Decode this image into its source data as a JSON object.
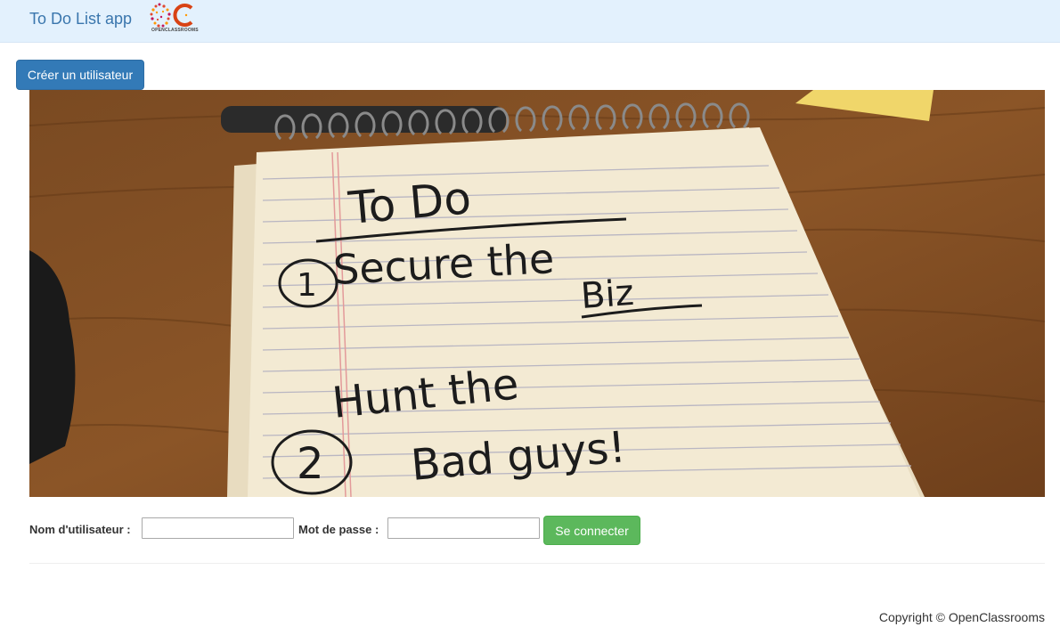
{
  "navbar": {
    "brand": "To Do List app",
    "logo_text": "OPENCLASSROOMS"
  },
  "actions": {
    "create_user_label": "Créer un utilisateur"
  },
  "hero": {
    "notebook_title": "To Do",
    "item_1": "Secure the",
    "item_1_b": "Biz",
    "item_2_a": "Hunt the",
    "item_2_b": "Bad guys!",
    "num_1": "1",
    "num_2": "2"
  },
  "login": {
    "username_label": "Nom d'utilisateur :",
    "username_value": "",
    "password_label": "Mot de passe :",
    "password_value": "",
    "submit_label": "Se connecter"
  },
  "footer": {
    "copyright": "Copyright © OpenClassrooms"
  },
  "colors": {
    "navbar_bg": "#e3f1fd",
    "brand": "#3a76ad",
    "primary": "#337ab7",
    "success": "#5cb85c"
  }
}
